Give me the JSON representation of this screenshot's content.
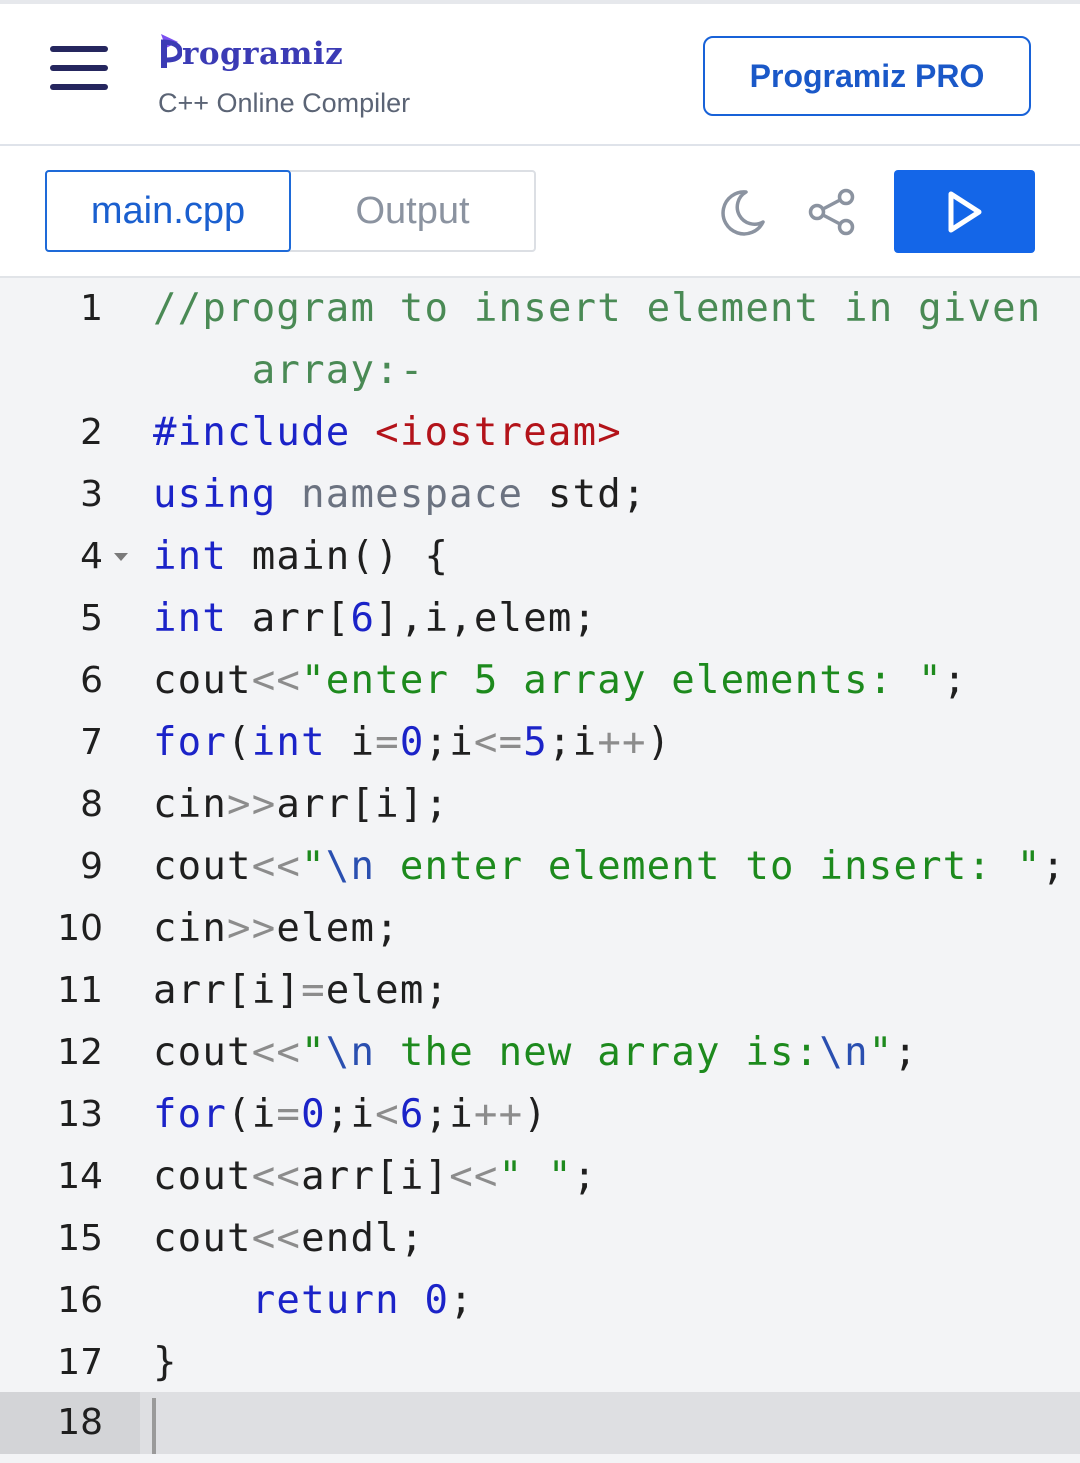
{
  "header": {
    "logo_text": "rogramiz",
    "logo_initial": "P",
    "subtitle": "C++ Online Compiler",
    "pro_button": "Programiz PRO"
  },
  "toolbar": {
    "tabs": [
      "main.cpp",
      "Output"
    ],
    "active_tab": "main.cpp"
  },
  "editor": {
    "line_numbers": [
      "1",
      "2",
      "3",
      "4",
      "5",
      "6",
      "7",
      "8",
      "9",
      "10",
      "11",
      "12",
      "13",
      "14",
      "15",
      "16",
      "17",
      "18"
    ],
    "lines": [
      "//program to insert element in given",
      "    array:-",
      "#include <iostream>",
      "using namespace std;",
      "int main() {",
      "int arr[6],i,elem;",
      "cout<<\"enter 5 array elements: \";",
      "for(int i=0;i<=5;i++)",
      "cin>>arr[i];",
      "cout<<\"\\n enter element to insert: \";",
      "cin>>elem;",
      "arr[i]=elem;",
      "cout<<\"\\n the new array is:\\n\";",
      "for(i=0;i<6;i++)",
      "cout<<arr[i]<<\" \";",
      "cout<<endl;",
      "    return 0;",
      "}",
      ""
    ]
  },
  "colors": {
    "brand": "#1466e8",
    "comment": "#4a8a55",
    "keyword": "#1b23c8",
    "string": "#1d8a1d",
    "include": "#b3131a"
  }
}
